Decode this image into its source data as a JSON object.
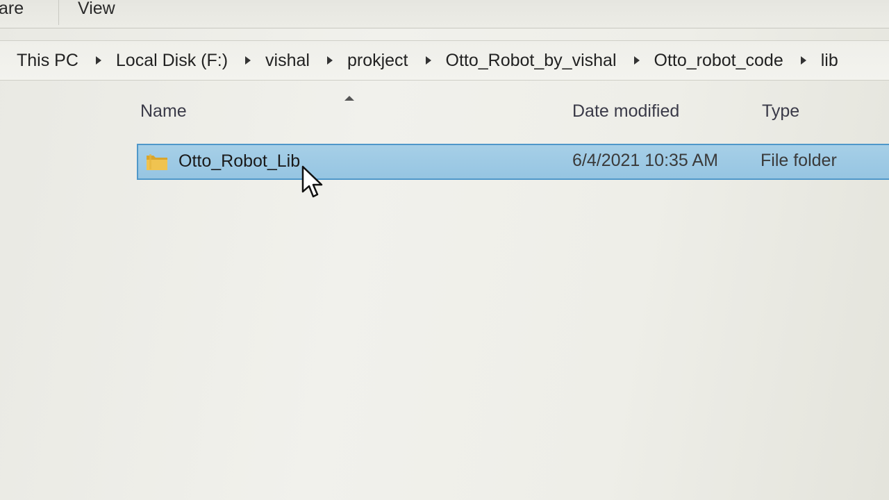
{
  "ribbon": {
    "tabs": [
      {
        "label": "are"
      },
      {
        "label": "View"
      }
    ]
  },
  "address": {
    "crumbs": [
      "This PC",
      "Local Disk (F:)",
      "vishal",
      "prokject",
      "Otto_Robot_by_vishal",
      "Otto_robot_code",
      "lib"
    ]
  },
  "columns": {
    "name": "Name",
    "date_modified": "Date modified",
    "type": "Type"
  },
  "files": [
    {
      "name": "Otto_Robot_Lib",
      "date_modified": "6/4/2021 10:35 AM",
      "type": "File folder",
      "icon": "folder-icon",
      "selected": true
    }
  ],
  "colors": {
    "selection": "#9ecae4",
    "selection_border": "#4f97c9",
    "folder": "#e8b83a"
  }
}
